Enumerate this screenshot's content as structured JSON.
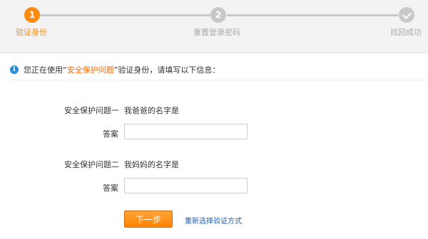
{
  "steps": [
    {
      "number": "1",
      "label": "验证身份",
      "state": "active"
    },
    {
      "number": "2",
      "label": "重置登录密码",
      "state": "pending"
    },
    {
      "number": "",
      "label": "找回成功",
      "state": "pending",
      "icon": "check-icon"
    }
  ],
  "info": {
    "icon": "info-icon",
    "icon_glyph": "i",
    "prefix": "您正在使用",
    "quote_open": "“",
    "highlight": "安全保护问题",
    "quote_close": "”",
    "suffix": "验证身份，请填写以下信息："
  },
  "questions": [
    {
      "label": "安全保护问题一",
      "question": "我爸爸的名字是",
      "answer_label": "答案",
      "answer_value": "",
      "answer_placeholder": ""
    },
    {
      "label": "安全保护问题二",
      "question": "我妈妈的名字是",
      "answer_label": "答案",
      "answer_value": "",
      "answer_placeholder": ""
    }
  ],
  "actions": {
    "next_label": "下一步",
    "reselect_label": "重新选择验证方式"
  },
  "colors": {
    "accent": "#ff8a12",
    "inactive": "#c8c8c8",
    "link": "#1f5fb0",
    "info_icon": "#2a8fd8"
  }
}
